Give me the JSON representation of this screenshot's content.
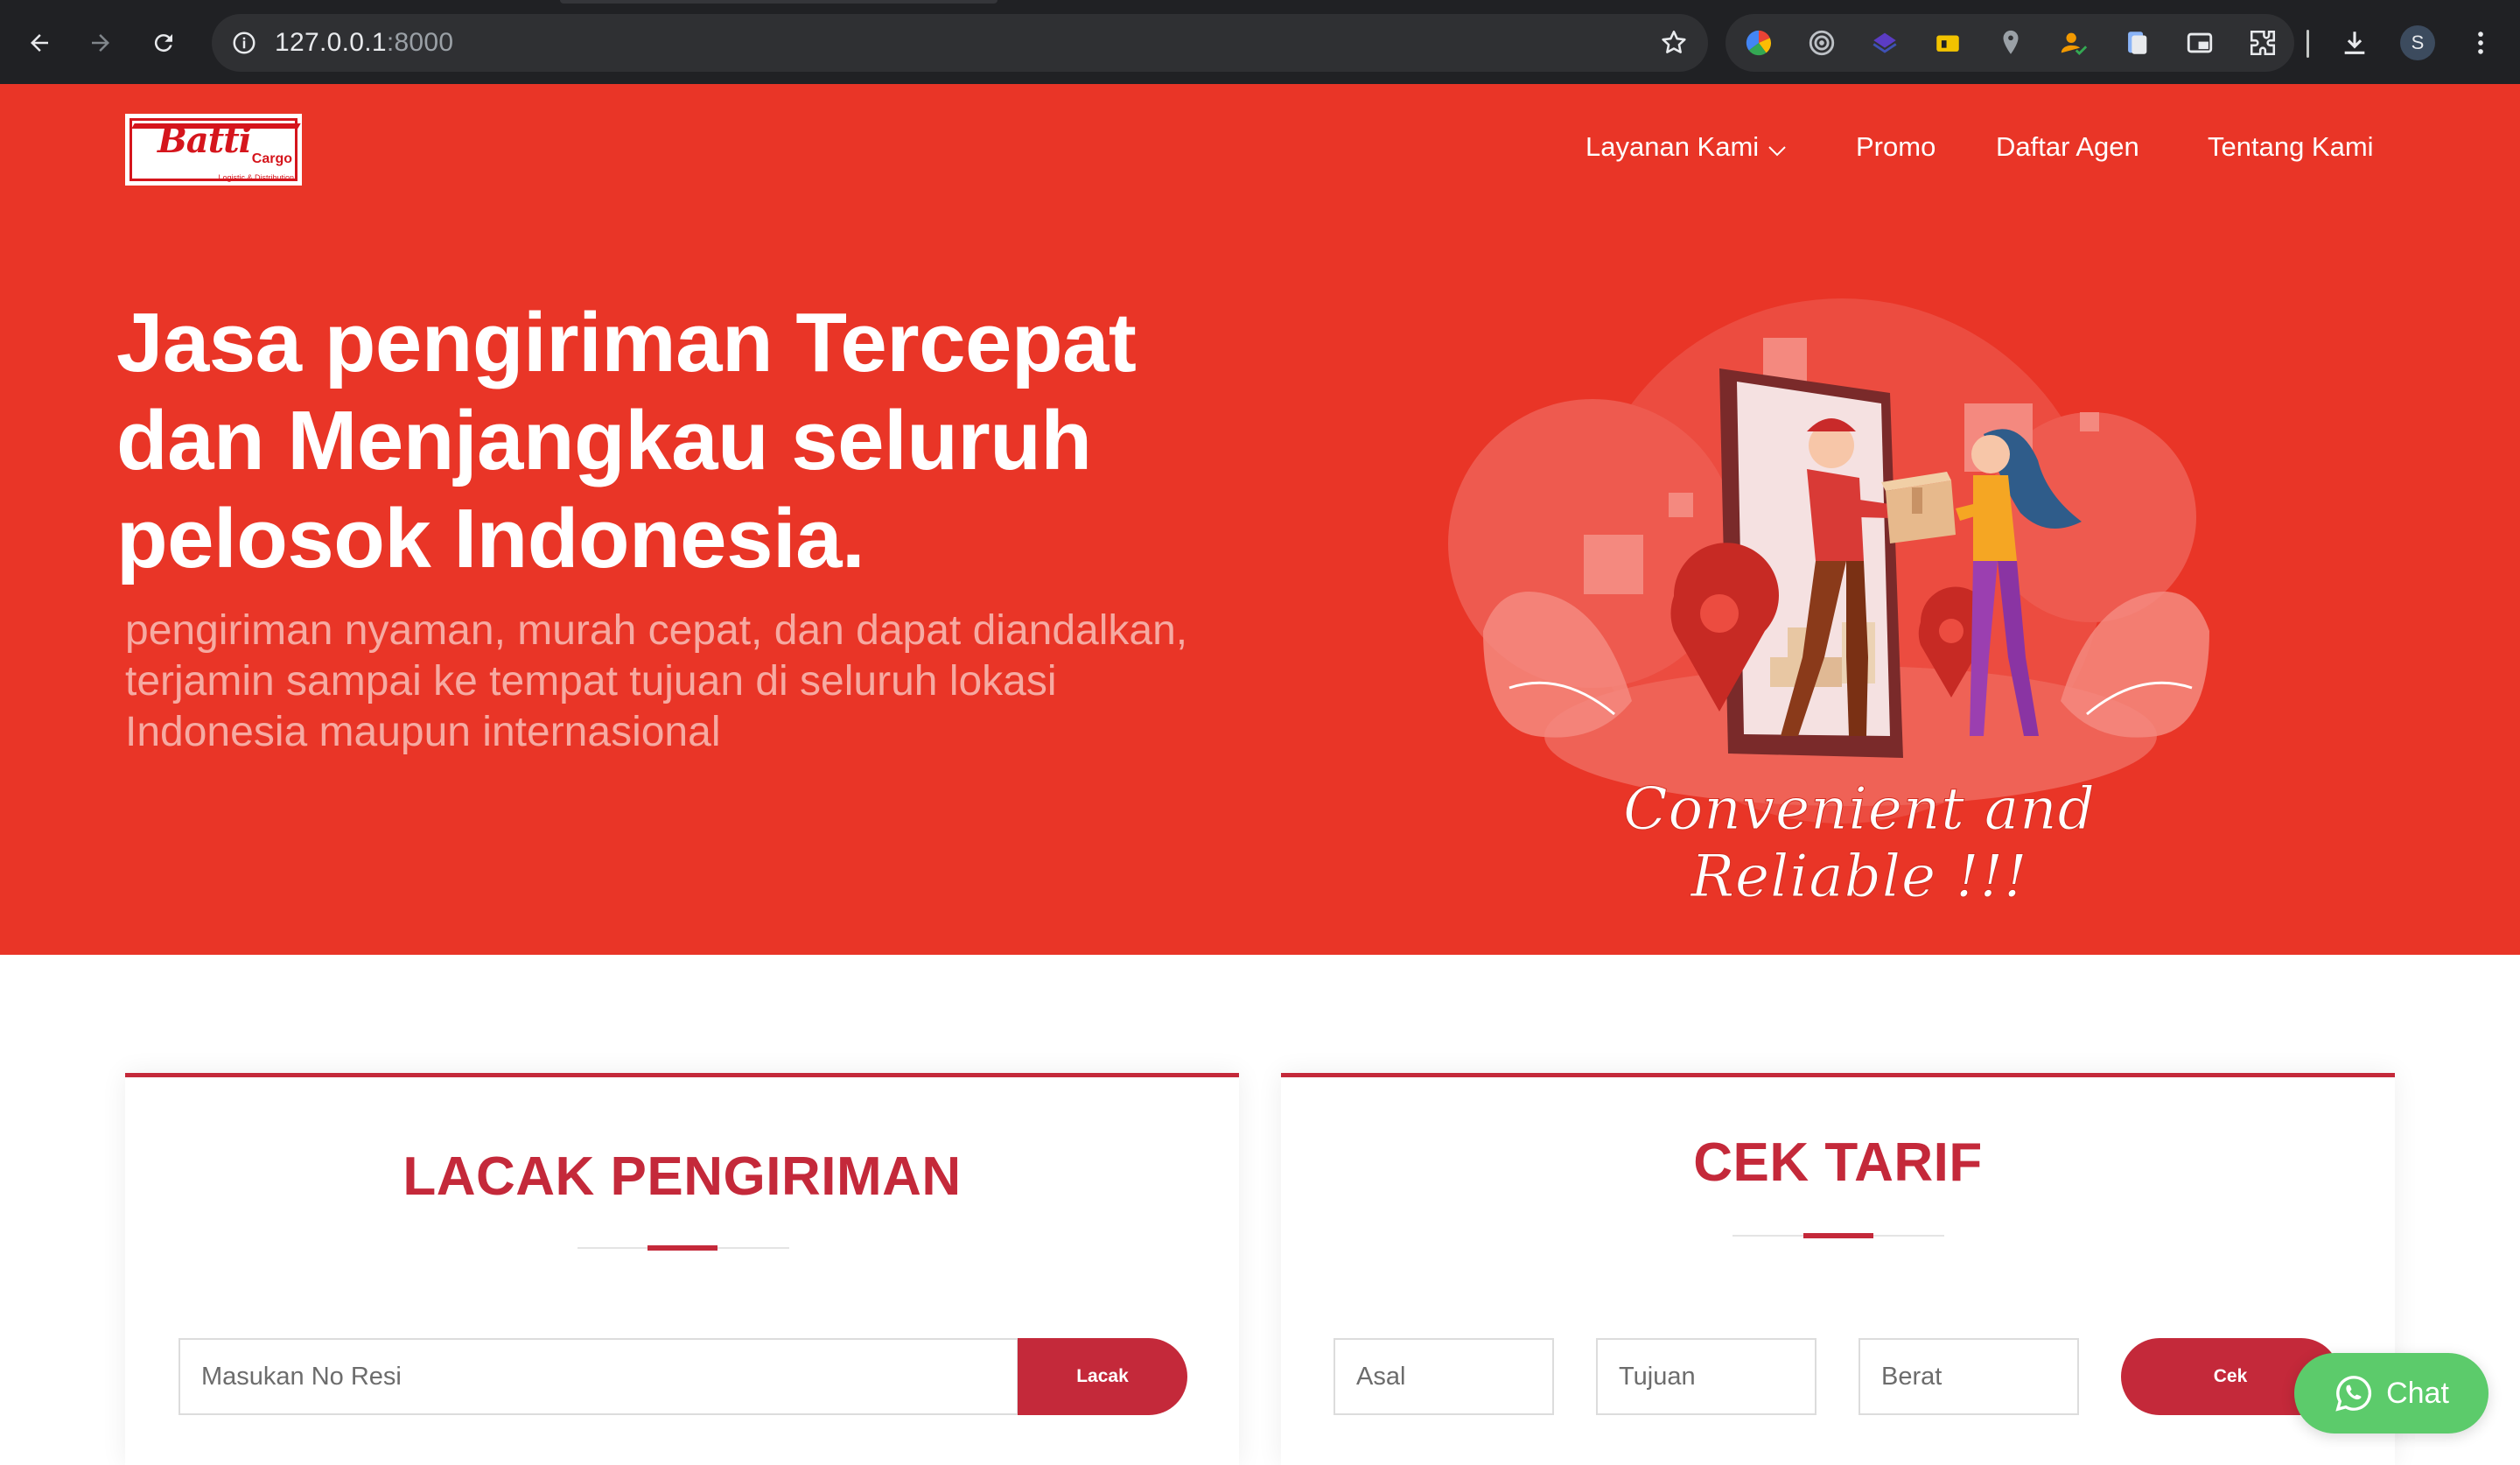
{
  "browser": {
    "url_host": "127.0.0.1",
    "url_port": ":8000",
    "profile_initial": "S",
    "icons": [
      "back-icon",
      "forward-icon",
      "reload-icon",
      "site-info-icon",
      "bookmark-star-icon",
      "extensions-puzzle-icon",
      "download-icon",
      "menu-kebab-icon"
    ]
  },
  "header": {
    "logo_word": "Batti",
    "logo_cargo": "Cargo",
    "logo_tagline": "Logistic & Distribution",
    "nav": [
      {
        "label": "Layanan Kami",
        "has_dropdown": true
      },
      {
        "label": "Promo"
      },
      {
        "label": "Daftar Agen"
      },
      {
        "label": "Tentang Kami"
      }
    ]
  },
  "hero": {
    "headline_lines": [
      "Jasa pengiriman Tercepat",
      "dan Menjangkau seluruh",
      "pelosok Indonesia."
    ],
    "sub_lines": [
      "pengiriman nyaman, murah cepat, dan dapat diandalkan,",
      "terjamin sampai ke tempat tujuan di seluruh lokasi",
      "Indonesia maupun internasional"
    ],
    "tagline": "Convenient and Reliable !!!"
  },
  "tracking": {
    "title": "LACAK PENGIRIMAN",
    "placeholder": "Masukan No Resi",
    "button": "Lacak"
  },
  "tariff": {
    "title": "CEK TARIF",
    "origin_placeholder": "Asal",
    "destination_placeholder": "Tujuan",
    "weight_placeholder": "Berat",
    "button": "Cek"
  },
  "chat": {
    "label": "Chat"
  },
  "colors": {
    "hero_bg": "#e93527",
    "accent": "#c4293a",
    "chat": "#5ccb6b",
    "chrome_bg": "#202124"
  }
}
